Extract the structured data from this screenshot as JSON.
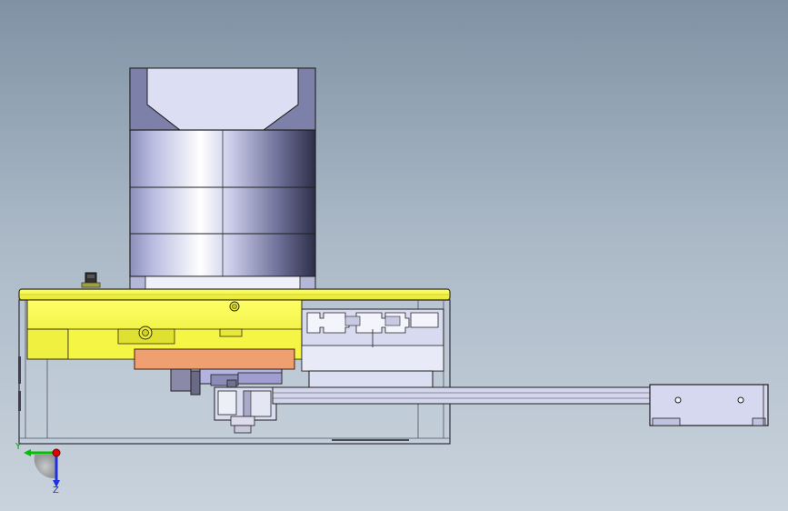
{
  "viewport": {
    "background_top": "#7f92a4",
    "background_bottom": "#c9d3dd"
  },
  "model": {
    "motor_color": "#c7cbe4",
    "housing_color": "#ffff44",
    "plate_color": "#f0a070",
    "rail_color": "#d4d6ec"
  },
  "triad": {
    "x_color": "#00c000",
    "y_label": "Y",
    "y_color": "#00a000",
    "z_label": "Z",
    "z_color": "#2030e0",
    "origin_color": "#e00000"
  }
}
